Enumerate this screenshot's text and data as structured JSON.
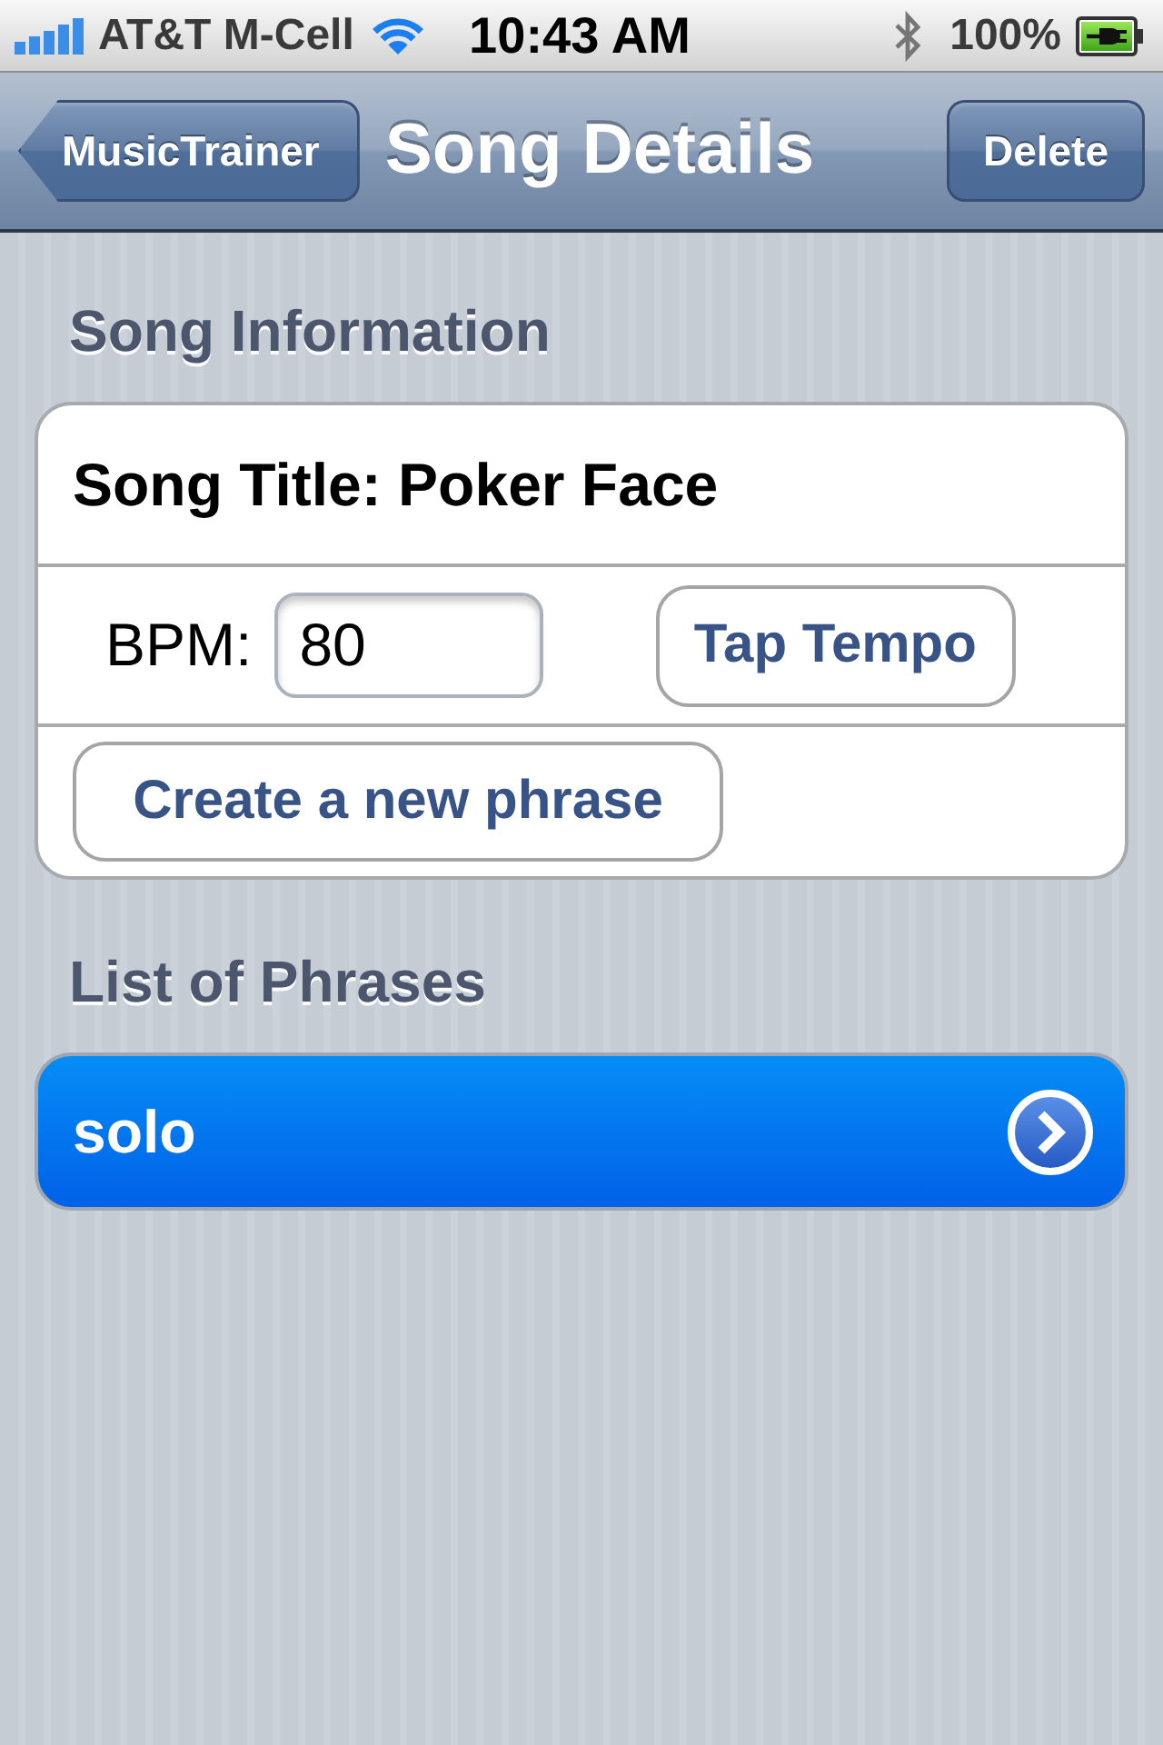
{
  "status_bar": {
    "carrier": "AT&T M-Cell",
    "time": "10:43 AM",
    "battery": "100%"
  },
  "nav_bar": {
    "back_button": "MusicTrainer",
    "title": "Song Details",
    "right_button": "Delete"
  },
  "song_information": {
    "header": "Song Information",
    "song_title": "Song Title: Poker Face",
    "bpm_label": "BPM:",
    "bpm_value": "80",
    "tap_tempo_button": "Tap Tempo",
    "new_phrase_button": "Create a new phrase"
  },
  "phrases": {
    "header": "List of Phrases",
    "items": [
      {
        "label": "solo",
        "selected": true
      }
    ]
  }
}
